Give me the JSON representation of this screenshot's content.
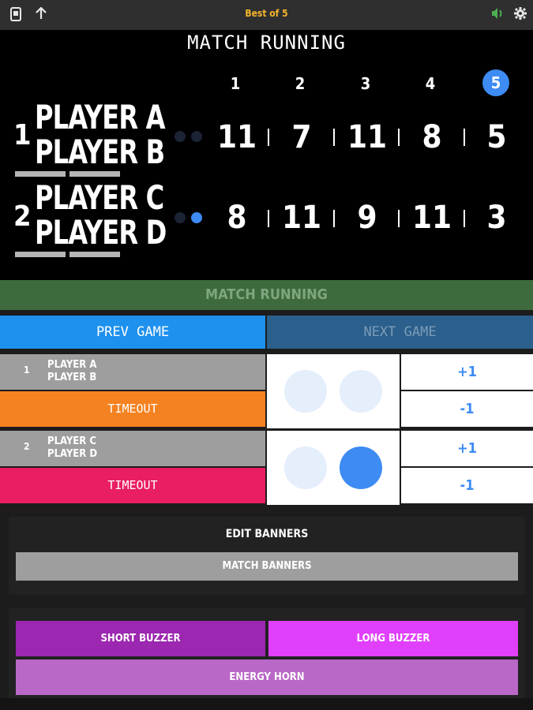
{
  "header": {
    "title": "Best of 5",
    "left_icons": [
      "scoreboard-device-icon",
      "arrow-up-icon"
    ],
    "right_icons": [
      "speaker-icon",
      "gear-icon"
    ]
  },
  "board": {
    "state": "MATCH RUNNING",
    "games": [
      "1",
      "2",
      "3",
      "4",
      "5"
    ],
    "active_game": 5,
    "teams": [
      {
        "seed": "1",
        "player1": "PLAYER A",
        "player2": "PLAYER B",
        "dots": [
          false,
          false
        ],
        "scores": [
          "11",
          "7",
          "11",
          "8",
          "5"
        ]
      },
      {
        "seed": "2",
        "player1": "PLAYER C",
        "player2": "PLAYER D",
        "dots": [
          false,
          true
        ],
        "scores": [
          "8",
          "11",
          "9",
          "11",
          "3"
        ]
      }
    ]
  },
  "status": {
    "label": "MATCH RUNNING",
    "color": "#3d6b3d"
  },
  "nav": {
    "prev": "PREV GAME",
    "next": "NEXT GAME"
  },
  "controls": [
    {
      "seed": "1",
      "player1": "PLAYER A",
      "player2": "PLAYER B",
      "timeout": "TIMEOUT",
      "timeout_color": "#f58220",
      "plus": "+1",
      "minus": "-1",
      "dots": [
        false,
        false
      ]
    },
    {
      "seed": "2",
      "player1": "PLAYER C",
      "player2": "PLAYER D",
      "timeout": "TIMEOUT",
      "timeout_color": "#e91e63",
      "plus": "+1",
      "minus": "-1",
      "dots": [
        false,
        true
      ]
    }
  ],
  "banners": {
    "title": "EDIT BANNERS",
    "button": "MATCH BANNERS"
  },
  "sounds": {
    "short": "SHORT BUZZER",
    "long": "LONG BUZZER",
    "horn": "ENERGY HORN"
  }
}
